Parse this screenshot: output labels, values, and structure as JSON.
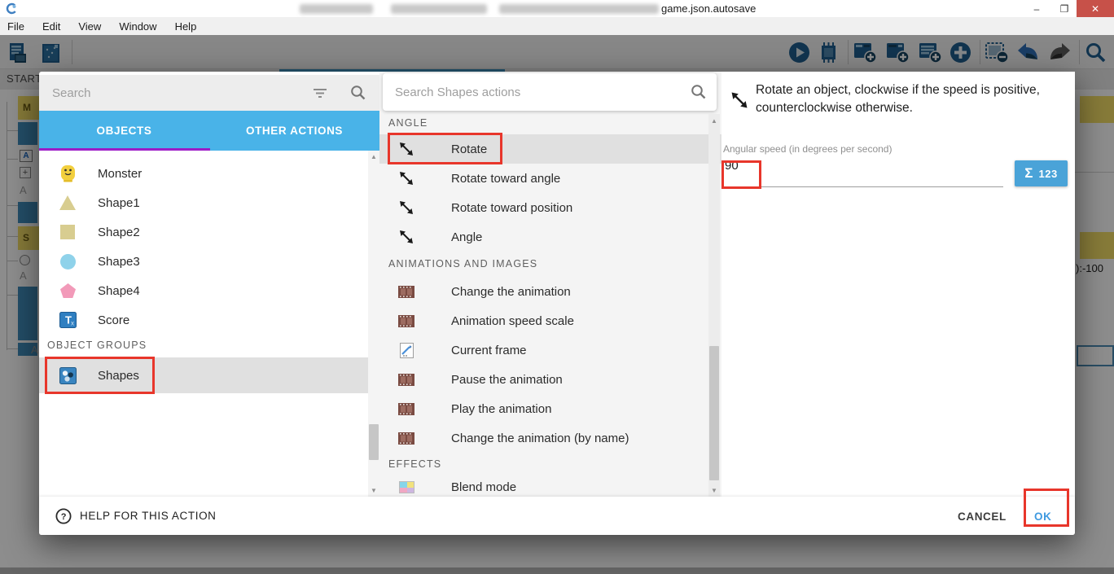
{
  "window": {
    "title_visible": "game.json.autosave",
    "minimize": "–",
    "restore": "❐",
    "close": "✕"
  },
  "menu": {
    "items": [
      "File",
      "Edit",
      "View",
      "Window",
      "Help"
    ]
  },
  "editor": {
    "tab_label": "START",
    "fragments": {
      "comment_m": "M",
      "comment_s": "S",
      "chip_letter": "A",
      "plus": "+",
      "add_letter": "A",
      "value_tail": "):-100"
    }
  },
  "dialog": {
    "left": {
      "search_placeholder": "Search",
      "tabs": [
        "OBJECTS",
        "OTHER ACTIONS"
      ],
      "active_tab": "OBJECTS",
      "objects": [
        "Monster",
        "Shape1",
        "Shape2",
        "Shape3",
        "Shape4",
        "Score"
      ],
      "groups_header": "OBJECT GROUPS",
      "groups": [
        "Shapes"
      ],
      "selected_group": "Shapes"
    },
    "actions": {
      "search_placeholder": "Search Shapes actions",
      "sections": [
        {
          "header": "ANGLE",
          "items": [
            "Rotate",
            "Rotate toward angle",
            "Rotate toward position",
            "Angle"
          ]
        },
        {
          "header": "ANIMATIONS AND IMAGES",
          "items": [
            "Change the animation",
            "Animation speed scale",
            "Current frame",
            "Pause the animation",
            "Play the animation",
            "Change the animation (by name)"
          ]
        },
        {
          "header": "EFFECTS",
          "items": [
            "Blend mode"
          ]
        }
      ],
      "selected_item": "Rotate"
    },
    "details": {
      "description_line1": "Rotate an object, clockwise if the speed is positive,",
      "description_line2": "counterclockwise otherwise.",
      "param_label": "Angular speed (in degrees per second)",
      "param_value": "90",
      "sigma": "Σ",
      "expression_button": "123"
    },
    "footer": {
      "help_label": "HELP FOR THIS ACTION",
      "cancel_label": "CANCEL",
      "ok_label": "OK"
    }
  },
  "colors": {
    "tab_blue": "#49b3e8",
    "tab_indicator_purple": "#9d1cc6",
    "selected_row_gray": "#e0e0e0",
    "annotation_red": "#e8362b",
    "expression_button_blue": "#4aa3d8",
    "close_button_red": "#c75149",
    "active_editor_tab_teal": "#3f93c0"
  }
}
